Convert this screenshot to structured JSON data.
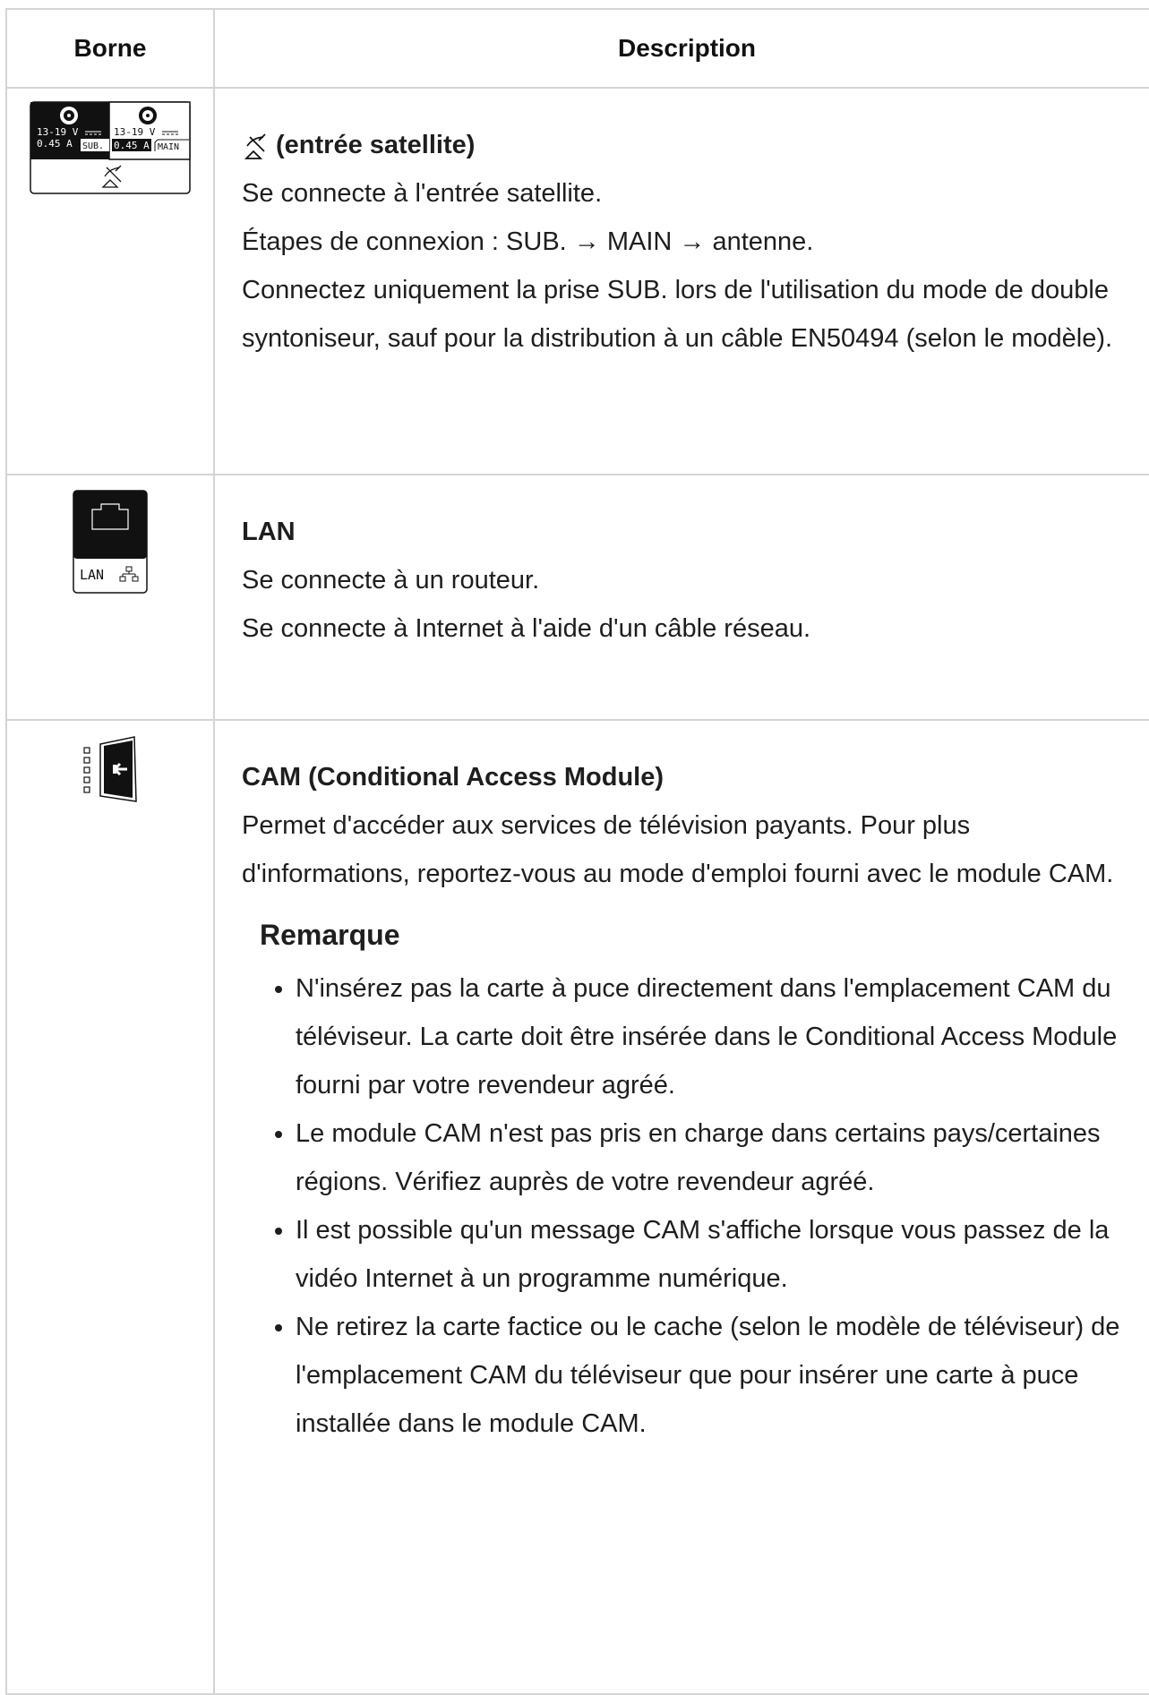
{
  "table": {
    "header": {
      "terminal": "Borne",
      "description": "Description"
    },
    "rows": [
      {
        "title": "(entrée satellite)",
        "title_icon": "satellite-dish-icon",
        "lines": [
          "Se connecte à l'entrée satellite.",
          "Étapes de connexion : SUB. → MAIN → antenne.",
          "Connectez uniquement la prise SUB. lors de l'utilisation du mode de double syntoniseur, sauf pour la distribution à un câble EN50494 (selon le modèle)."
        ],
        "port_icon": {
          "name": "satellite-input-port-icon",
          "sub": {
            "voltage": "13-19 V",
            "current": "0.45 A",
            "label": "SUB."
          },
          "main": {
            "voltage": "13-19 V",
            "current": "0.45 A",
            "label": "MAIN"
          }
        }
      },
      {
        "title": "LAN",
        "lines": [
          "Se connecte à un routeur.",
          "Se connecte à Internet à l'aide d'un câble réseau."
        ],
        "port_icon": {
          "name": "lan-port-icon",
          "label": "LAN"
        }
      },
      {
        "title": "CAM (Conditional Access Module)",
        "lines": [
          "Permet d'accéder aux services de télévision payants. Pour plus d'informations, reportez-vous au mode d'emploi fourni avec le module CAM."
        ],
        "port_icon": {
          "name": "cam-slot-icon"
        },
        "note": {
          "title": "Remarque",
          "items": [
            "N'insérez pas la carte à puce directement dans l'emplacement CAM du téléviseur. La carte doit être insérée dans le Conditional Access Module fourni par votre revendeur agréé.",
            "Le module CAM n'est pas pris en charge dans certains pays/certaines régions. Vérifiez auprès de votre revendeur agréé.",
            "Il est possible qu'un message CAM s'affiche lorsque vous passez de la vidéo Internet à un programme numérique.",
            "Ne retirez la carte factice ou le cache (selon le modèle de téléviseur) de l'emplacement CAM du téléviseur que pour insérer une carte à puce installée dans le module CAM."
          ]
        }
      }
    ]
  }
}
